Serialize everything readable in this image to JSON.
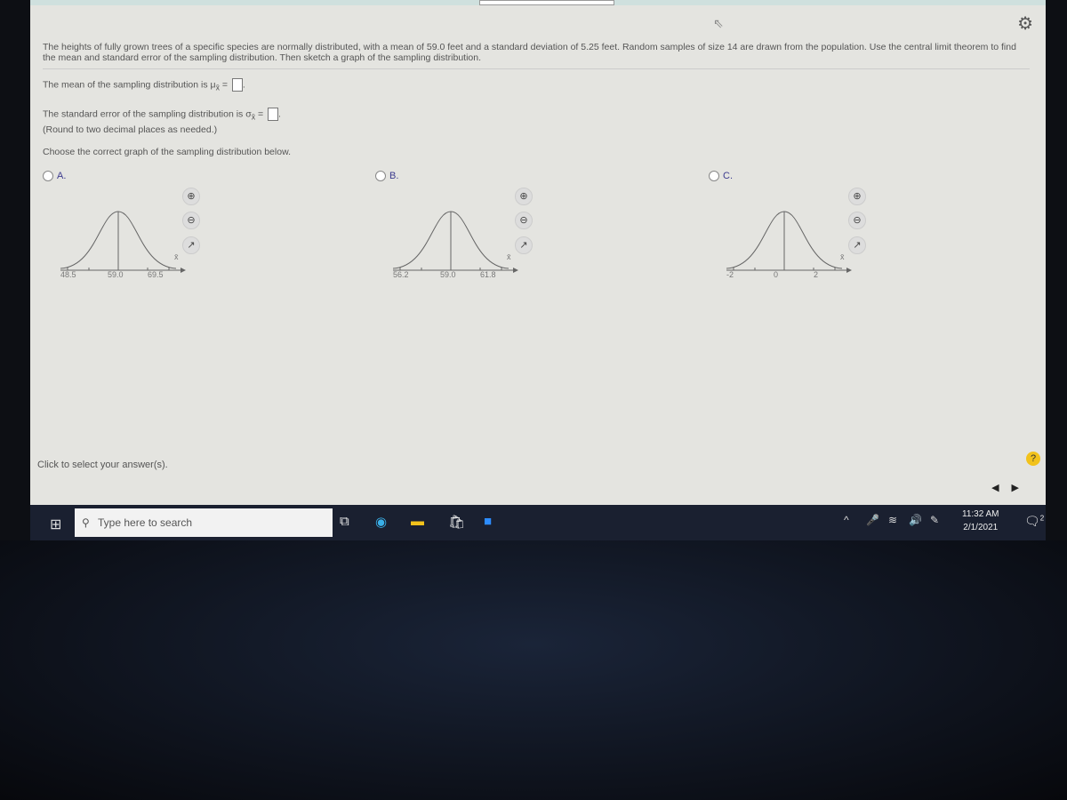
{
  "question": {
    "text": "The heights of fully grown trees of a specific species are normally distributed, with a mean of 59.0 feet and a standard deviation of 5.25 feet. Random samples of size 14 are drawn from the population. Use the central limit theorem to find the mean and standard error of the sampling distribution. Then sketch a graph of the sampling distribution.",
    "mean_prompt": "The mean of the sampling distribution is μ",
    "se_prompt": "The standard error of the sampling distribution is σ",
    "subscript": "x̄",
    "mean_value": "",
    "se_value": "",
    "round_note": "(Round to two decimal places as needed.)",
    "choose_prompt": "Choose the correct graph of the sampling distribution below."
  },
  "options": [
    {
      "label": "A.",
      "ticks": [
        "48.5",
        "59.0",
        "69.5"
      ],
      "axis_label": "x̄"
    },
    {
      "label": "B.",
      "ticks": [
        "56.2",
        "59.0",
        "61.8"
      ],
      "axis_label": "x̄"
    },
    {
      "label": "C.",
      "ticks": [
        "-2",
        "0",
        "2"
      ],
      "axis_label": "x̄"
    }
  ],
  "footer": {
    "status": "Click to select your answer(s).",
    "help": "?"
  },
  "taskbar": {
    "search_placeholder": "Type here to search",
    "time": "11:32 AM",
    "date": "2/1/2021",
    "notifications": "2"
  },
  "colors": {
    "accent": "#3d3b8e",
    "help": "#f2c21b",
    "taskbar": "#1a2030"
  }
}
